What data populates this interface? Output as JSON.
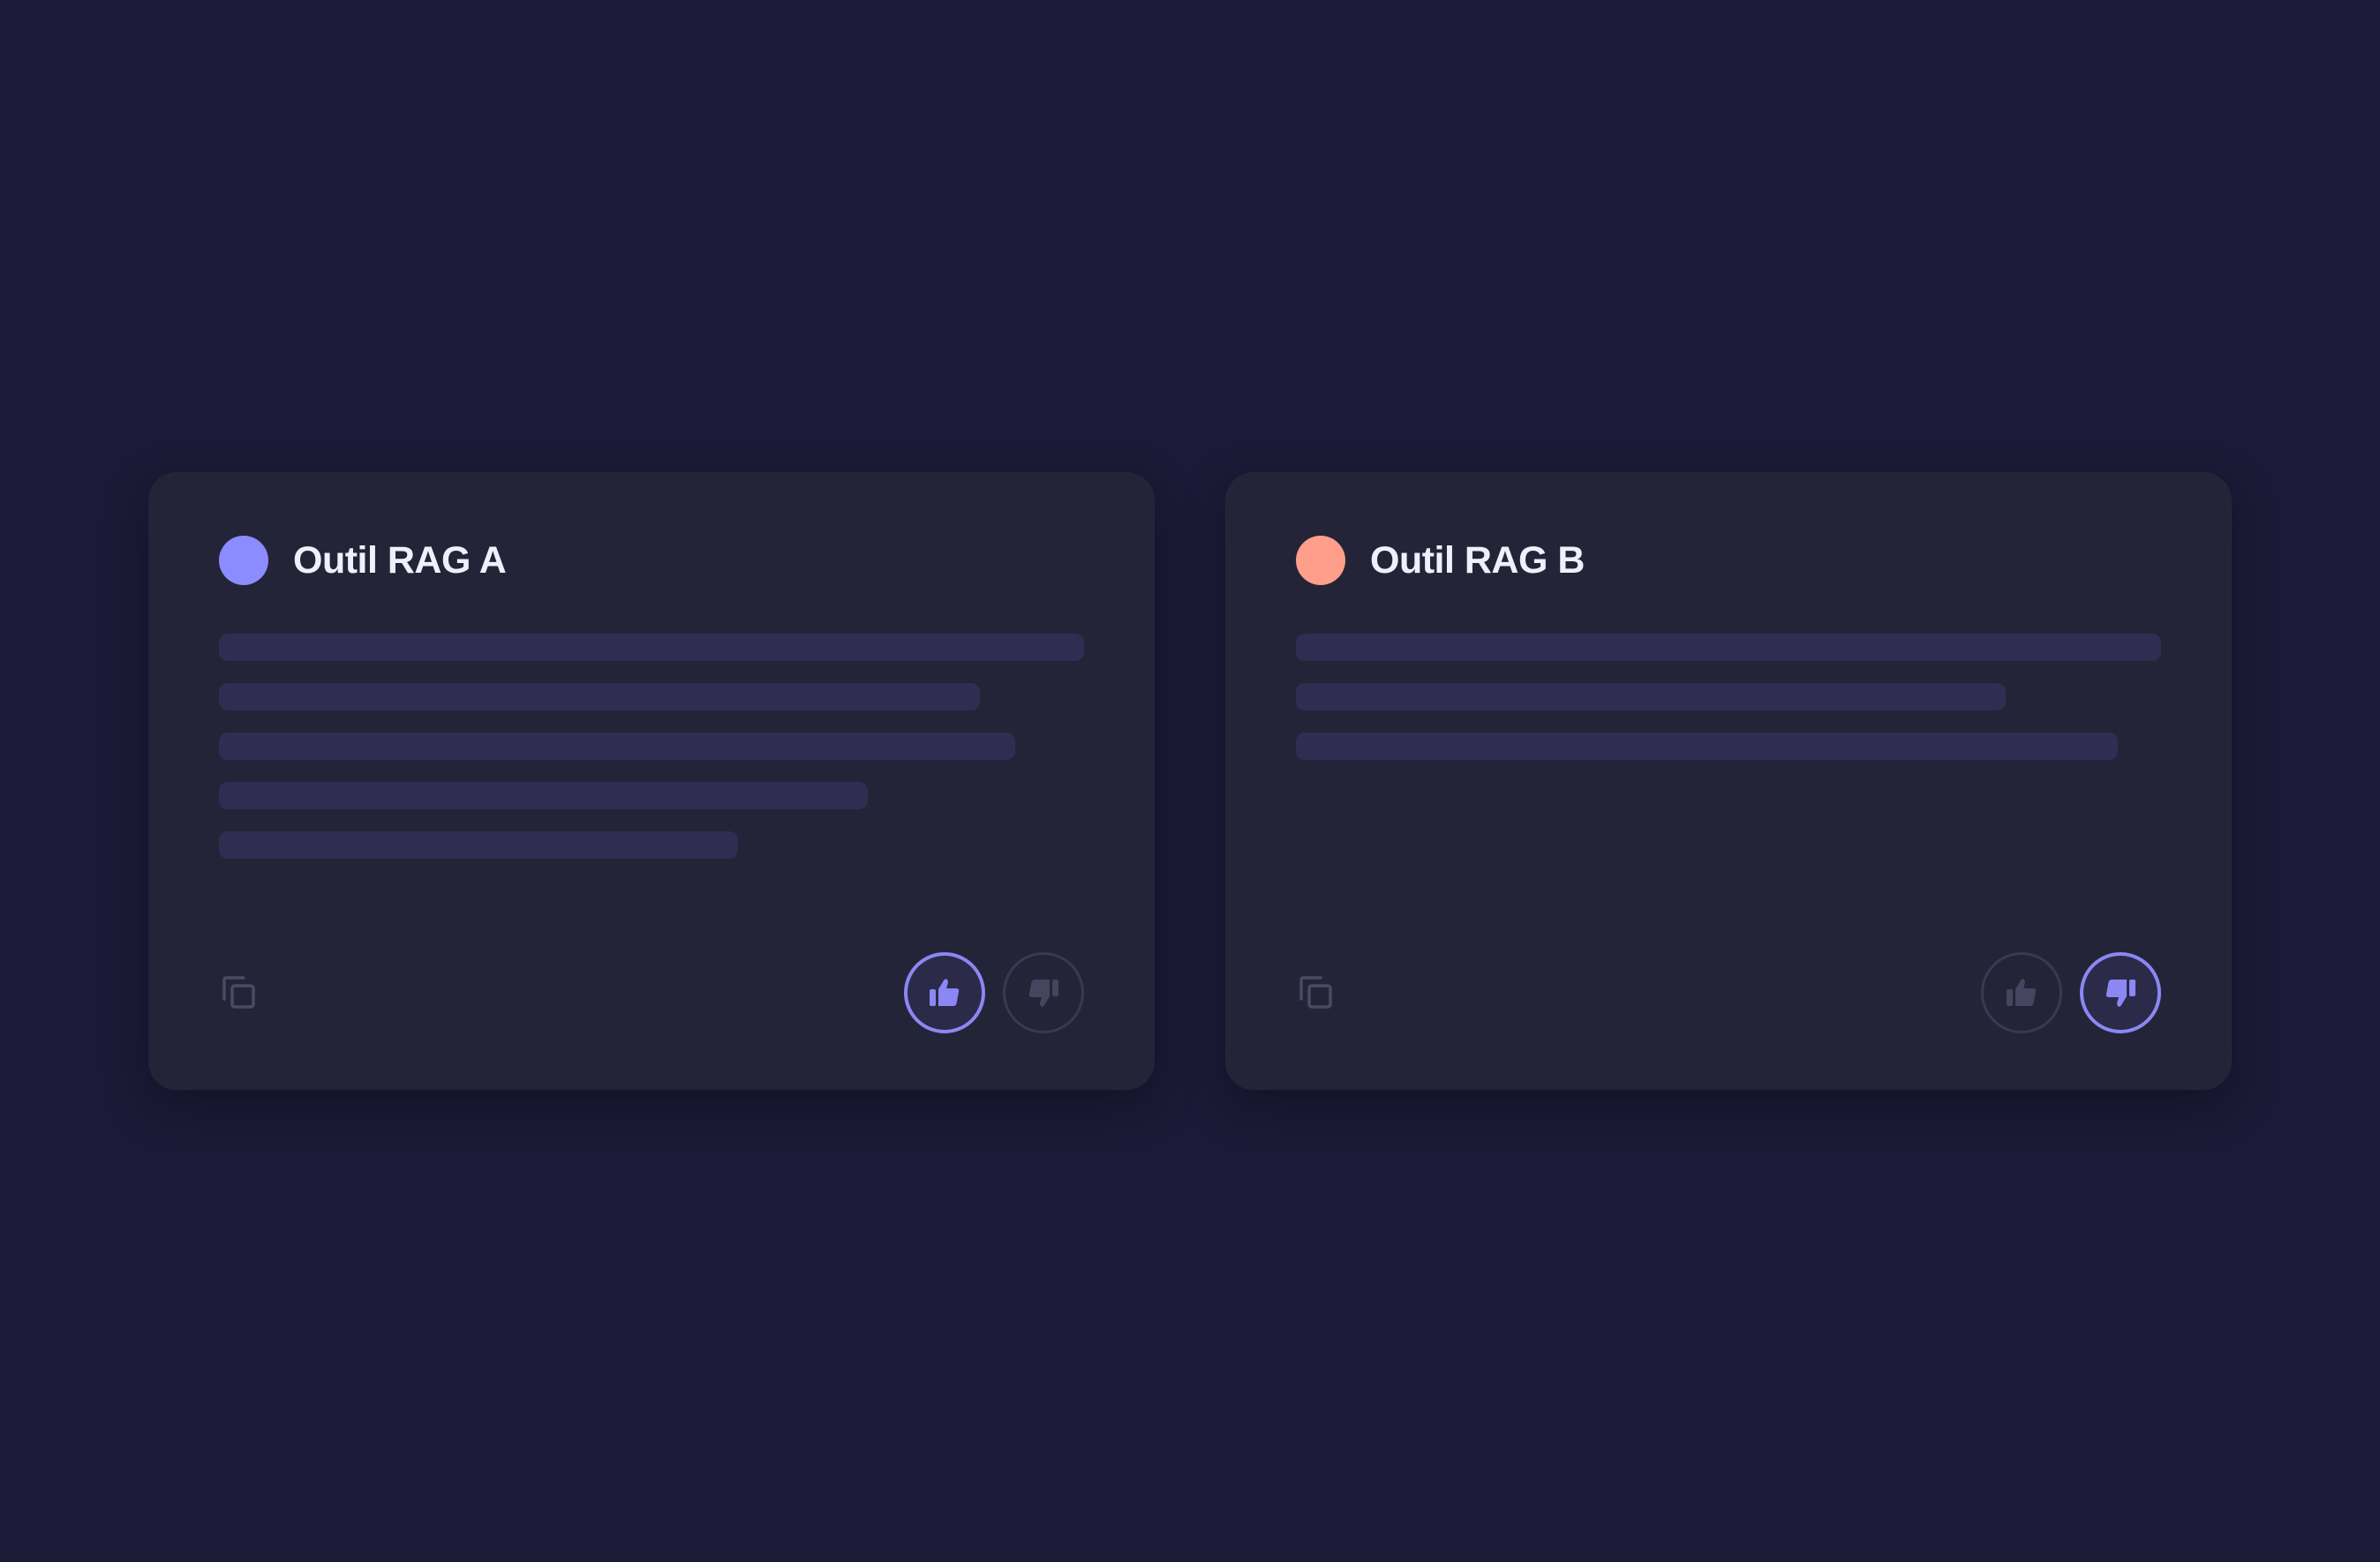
{
  "page": {
    "background": "#1c1b37",
    "card_background": "#242438",
    "placeholder_line_color": "#2f2e52",
    "accent": "#8b87f4"
  },
  "cards": [
    {
      "title": "Outil RAG A",
      "dot_color": "#8b8cff",
      "placeholder_line_fractions": [
        1.0,
        0.88,
        0.92,
        0.75,
        0.6
      ],
      "copy_icon": "copy-icon",
      "vote": {
        "selected": "thumbs-up"
      }
    },
    {
      "title": "Outil RAG B",
      "dot_color": "#ff9e8a",
      "placeholder_line_fractions": [
        1.0,
        0.82,
        0.95
      ],
      "copy_icon": "copy-icon",
      "vote": {
        "selected": "thumbs-down"
      }
    }
  ]
}
